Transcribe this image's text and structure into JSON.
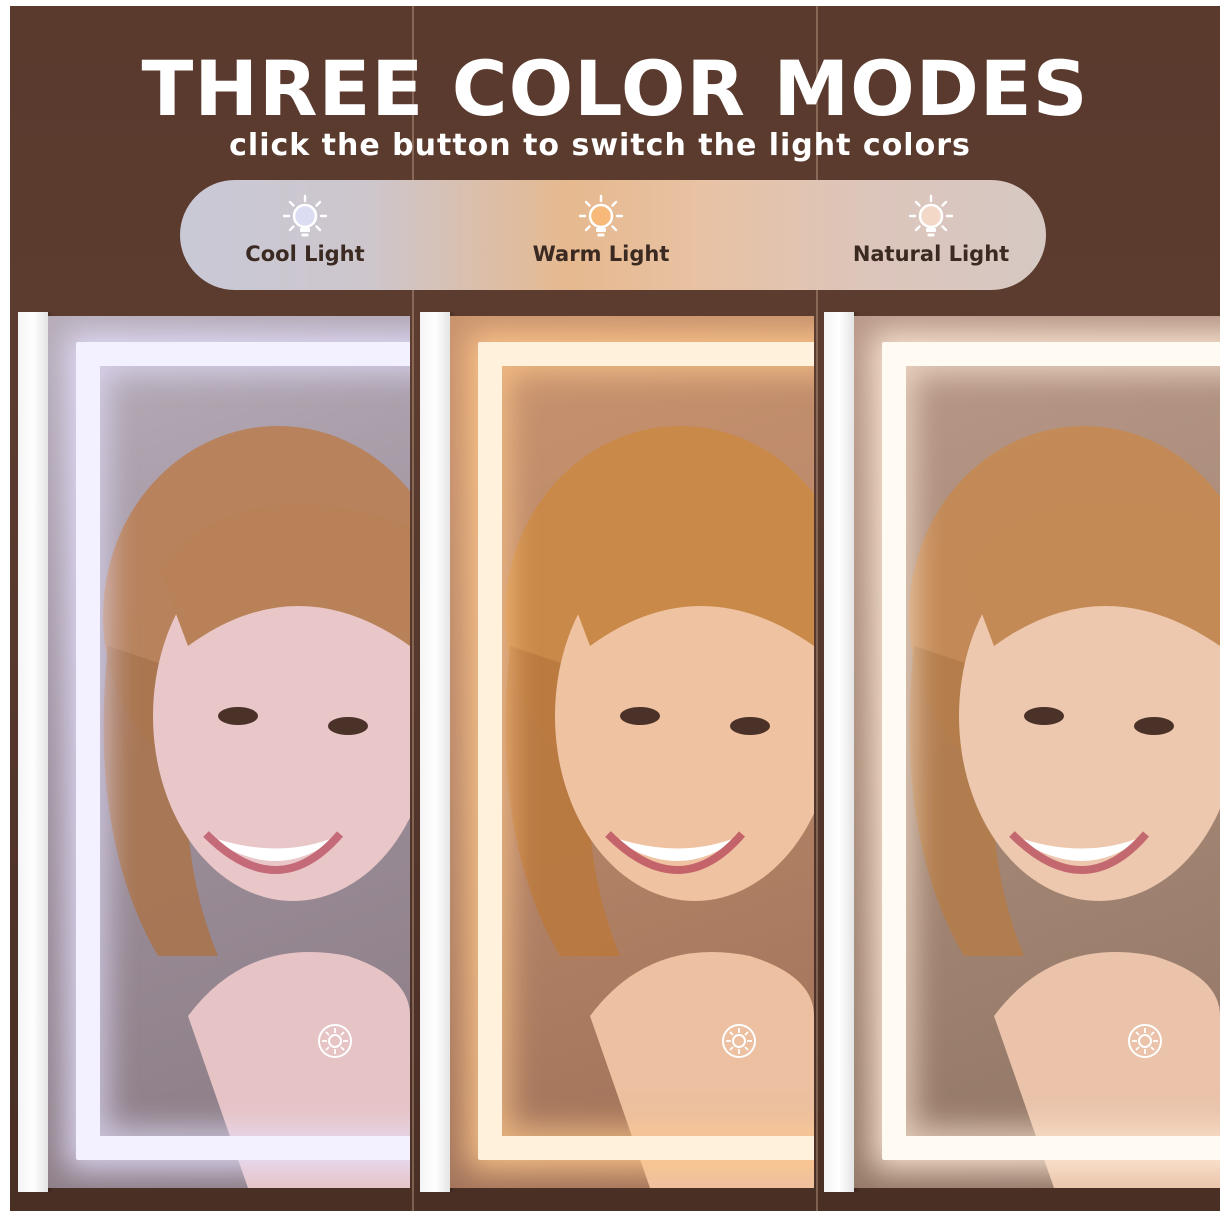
{
  "header": {
    "title": "THREE COLOR MODES",
    "subtitle": "click the button to switch the light colors"
  },
  "modes": [
    {
      "label": "Cool Light",
      "icon": "bulb-icon",
      "color": "#dcdcf2"
    },
    {
      "label": "Warm Light",
      "icon": "bulb-icon",
      "color": "#f6b97a"
    },
    {
      "label": "Natural Light",
      "icon": "bulb-icon",
      "color": "#f3d8c8"
    }
  ],
  "panels": [
    {
      "mode": "cool",
      "ledColor": "#f3f1ff",
      "mirrorTone": "#a79aa8",
      "skinTone": "#e9c7c8",
      "hairTone": "#b88158"
    },
    {
      "mode": "warm",
      "ledColor": "#fff1dc",
      "mirrorTone": "#b8876a",
      "skinTone": "#efc3a2",
      "hairTone": "#c98948"
    },
    {
      "mode": "natural",
      "ledColor": "#fffaf2",
      "mirrorTone": "#a88a78",
      "skinTone": "#edc7ae",
      "hairTone": "#c48a55"
    }
  ],
  "icons": {
    "touch": "touch-button-icon"
  },
  "colors": {
    "background": "#5a3a2d",
    "label": "#3b2a22"
  }
}
